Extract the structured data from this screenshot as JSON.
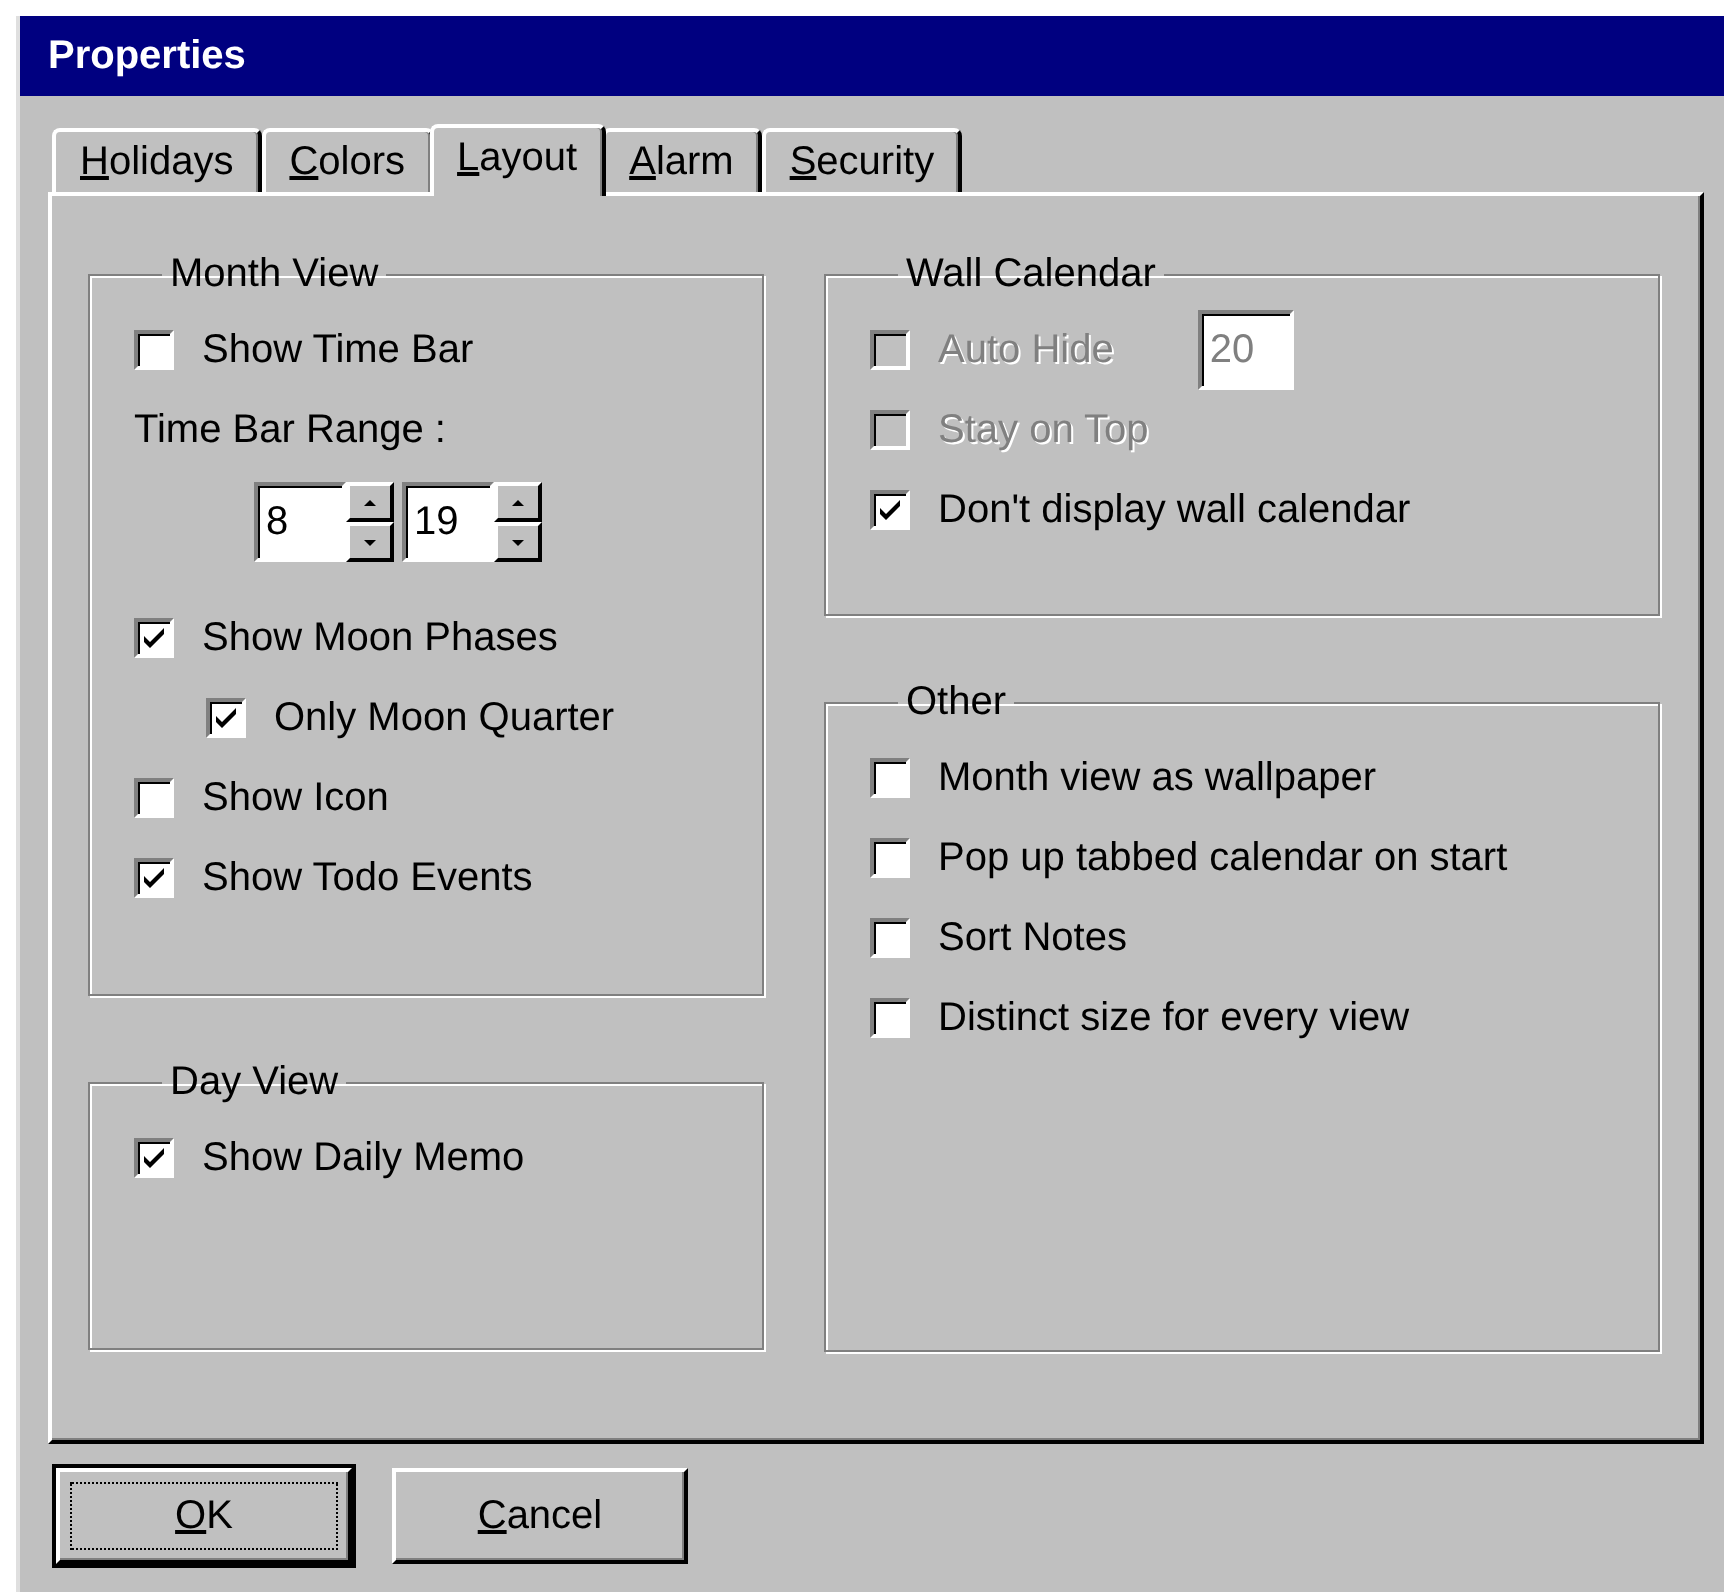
{
  "window": {
    "title": "Properties"
  },
  "tabs": [
    {
      "label": "Holidays",
      "selected": false
    },
    {
      "label": "Colors",
      "selected": false
    },
    {
      "label": "Layout",
      "selected": true
    },
    {
      "label": "Alarm",
      "selected": false
    },
    {
      "label": "Security",
      "selected": false
    }
  ],
  "left_column": [
    {
      "title": "Month View",
      "items": [
        {
          "kind": "checkbox",
          "label": "Show Time Bar",
          "checked": false,
          "disabled": false
        },
        {
          "kind": "label",
          "label": "Time Bar Range :"
        },
        {
          "kind": "spinners",
          "values": [
            "8",
            "19"
          ]
        },
        {
          "kind": "checkbox",
          "label": "Show Moon Phases",
          "checked": true,
          "disabled": false,
          "children": [
            {
              "kind": "checkbox",
              "label": "Only Moon Quarter",
              "checked": true,
              "disabled": false
            }
          ]
        },
        {
          "kind": "checkbox",
          "label": "Show Icon",
          "checked": false,
          "disabled": false
        },
        {
          "kind": "checkbox",
          "label": "Show Todo Events",
          "checked": true,
          "disabled": false
        }
      ]
    },
    {
      "title": "Day View",
      "items": [
        {
          "kind": "checkbox",
          "label": "Show Daily Memo",
          "checked": true,
          "disabled": false
        }
      ]
    }
  ],
  "right_column": [
    {
      "title": "Wall Calendar",
      "items": [
        {
          "kind": "checkbox",
          "label": "Auto Hide",
          "checked": false,
          "disabled": true,
          "field": "20"
        },
        {
          "kind": "checkbox",
          "label": "Stay on Top",
          "checked": false,
          "disabled": true
        },
        {
          "kind": "checkbox",
          "label": "Don't display wall calendar",
          "checked": true,
          "disabled": false
        }
      ]
    },
    {
      "title": "Other",
      "items": [
        {
          "kind": "checkbox",
          "label": "Month view as wallpaper",
          "checked": false,
          "disabled": false
        },
        {
          "kind": "checkbox",
          "label": "Pop up tabbed calendar on start",
          "checked": false,
          "disabled": false
        },
        {
          "kind": "checkbox",
          "label": "Sort Notes",
          "checked": false,
          "disabled": false
        },
        {
          "kind": "checkbox",
          "label": "Distinct size for every view",
          "checked": false,
          "disabled": false
        }
      ]
    }
  ],
  "buttons": [
    {
      "label": "OK",
      "default": true
    },
    {
      "label": "Cancel",
      "default": false
    }
  ]
}
